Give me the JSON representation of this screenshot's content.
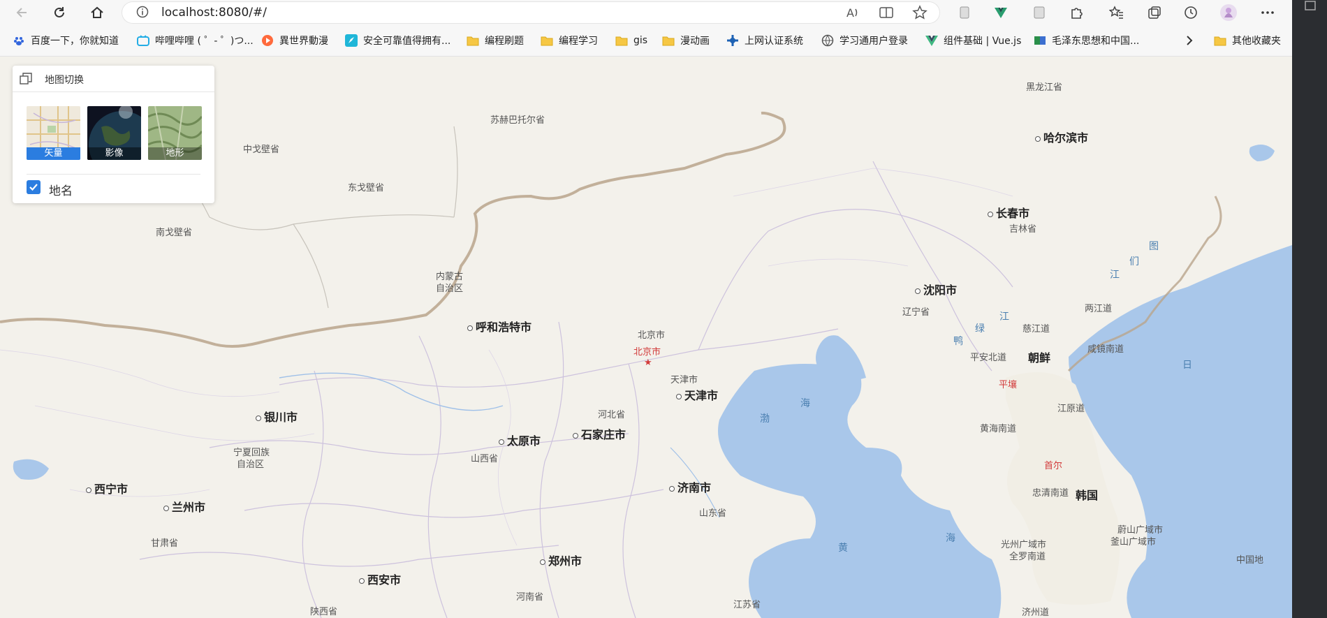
{
  "browser": {
    "url": "localhost:8080/#/",
    "bookmarks": [
      {
        "label": "百度一下，你就知道",
        "icon": "baidu-icon"
      },
      {
        "label": "哔哩哔哩 ( ゜- ゜)つ...",
        "icon": "bilibili-icon"
      },
      {
        "label": "異世界動漫",
        "icon": "play-icon"
      },
      {
        "label": "安全可靠值得拥有...",
        "icon": "rocket-icon"
      },
      {
        "label": "编程刷题",
        "icon": "folder-icon"
      },
      {
        "label": "编程学习",
        "icon": "folder-icon"
      },
      {
        "label": "gis",
        "icon": "folder-icon"
      },
      {
        "label": "漫动画",
        "icon": "folder-icon"
      },
      {
        "label": "上网认证系统",
        "icon": "network-icon"
      },
      {
        "label": "学习通用户登录",
        "icon": "globe-icon"
      },
      {
        "label": "组件基础 | Vue.js",
        "icon": "vue-icon"
      },
      {
        "label": "毛泽东思想和中国...",
        "icon": "book-icon"
      },
      {
        "label": "其他收藏夹",
        "icon": "folder-icon"
      }
    ]
  },
  "map_switch": {
    "title": "地图切换",
    "layers": [
      {
        "label": "矢量",
        "active": true
      },
      {
        "label": "影像",
        "active": false
      },
      {
        "label": "地形",
        "active": false
      }
    ],
    "placename_label": "地名",
    "placename_checked": true
  },
  "map": {
    "labels": [
      {
        "text": "黑龙江省",
        "kind": "province"
      },
      {
        "text": "哈尔滨市",
        "kind": "city"
      },
      {
        "text": "苏赫巴托尔省",
        "kind": "province"
      },
      {
        "text": "中戈壁省",
        "kind": "province"
      },
      {
        "text": "东戈壁省",
        "kind": "province"
      },
      {
        "text": "南戈壁省",
        "kind": "province"
      },
      {
        "text": "长春市",
        "kind": "city"
      },
      {
        "text": "吉林省",
        "kind": "province"
      },
      {
        "text": "内蒙古",
        "kind": "province"
      },
      {
        "text": "自治区",
        "kind": "province"
      },
      {
        "text": "沈阳市",
        "kind": "city"
      },
      {
        "text": "辽宁省",
        "kind": "province"
      },
      {
        "text": "呼和浩特市",
        "kind": "city"
      },
      {
        "text": "北京市",
        "kind": "province"
      },
      {
        "text": "北京市",
        "kind": "capital"
      },
      {
        "text": "天津市",
        "kind": "province"
      },
      {
        "text": "天津市",
        "kind": "city"
      },
      {
        "text": "银川市",
        "kind": "city"
      },
      {
        "text": "河北省",
        "kind": "province"
      },
      {
        "text": "石家庄市",
        "kind": "city"
      },
      {
        "text": "太原市",
        "kind": "city"
      },
      {
        "text": "山西省",
        "kind": "province"
      },
      {
        "text": "宁夏回族",
        "kind": "province"
      },
      {
        "text": "自治区",
        "kind": "province"
      },
      {
        "text": "西宁市",
        "kind": "city"
      },
      {
        "text": "兰州市",
        "kind": "city"
      },
      {
        "text": "甘肃省",
        "kind": "province"
      },
      {
        "text": "济南市",
        "kind": "city"
      },
      {
        "text": "山东省",
        "kind": "province"
      },
      {
        "text": "郑州市",
        "kind": "city"
      },
      {
        "text": "西安市",
        "kind": "city"
      },
      {
        "text": "河南省",
        "kind": "province"
      },
      {
        "text": "陕西省",
        "kind": "province"
      },
      {
        "text": "江苏省",
        "kind": "province"
      },
      {
        "text": "两江道",
        "kind": "province"
      },
      {
        "text": "慈江道",
        "kind": "province"
      },
      {
        "text": "朝鲜",
        "kind": "city"
      },
      {
        "text": "咸镜南道",
        "kind": "province"
      },
      {
        "text": "平安北道",
        "kind": "province"
      },
      {
        "text": "平壤",
        "kind": "capital"
      },
      {
        "text": "江原道",
        "kind": "province"
      },
      {
        "text": "黄海南道",
        "kind": "province"
      },
      {
        "text": "首尔",
        "kind": "capital"
      },
      {
        "text": "忠清南道",
        "kind": "province"
      },
      {
        "text": "韩国",
        "kind": "city"
      },
      {
        "text": "光州广域市",
        "kind": "province"
      },
      {
        "text": "全罗南道",
        "kind": "province"
      },
      {
        "text": "蔚山广域市",
        "kind": "province"
      },
      {
        "text": "釜山广域市",
        "kind": "province"
      },
      {
        "text": "中国地",
        "kind": "province"
      },
      {
        "text": "济州道",
        "kind": "province"
      },
      {
        "text": "海",
        "kind": "sea"
      },
      {
        "text": "渤",
        "kind": "sea"
      },
      {
        "text": "黄",
        "kind": "sea"
      },
      {
        "text": "海",
        "kind": "sea"
      },
      {
        "text": "日",
        "kind": "sea"
      },
      {
        "text": "江",
        "kind": "sea"
      },
      {
        "text": "们",
        "kind": "sea"
      },
      {
        "text": "图",
        "kind": "sea"
      },
      {
        "text": "鸭",
        "kind": "sea"
      },
      {
        "text": "绿",
        "kind": "sea"
      },
      {
        "text": "江",
        "kind": "sea"
      }
    ]
  }
}
